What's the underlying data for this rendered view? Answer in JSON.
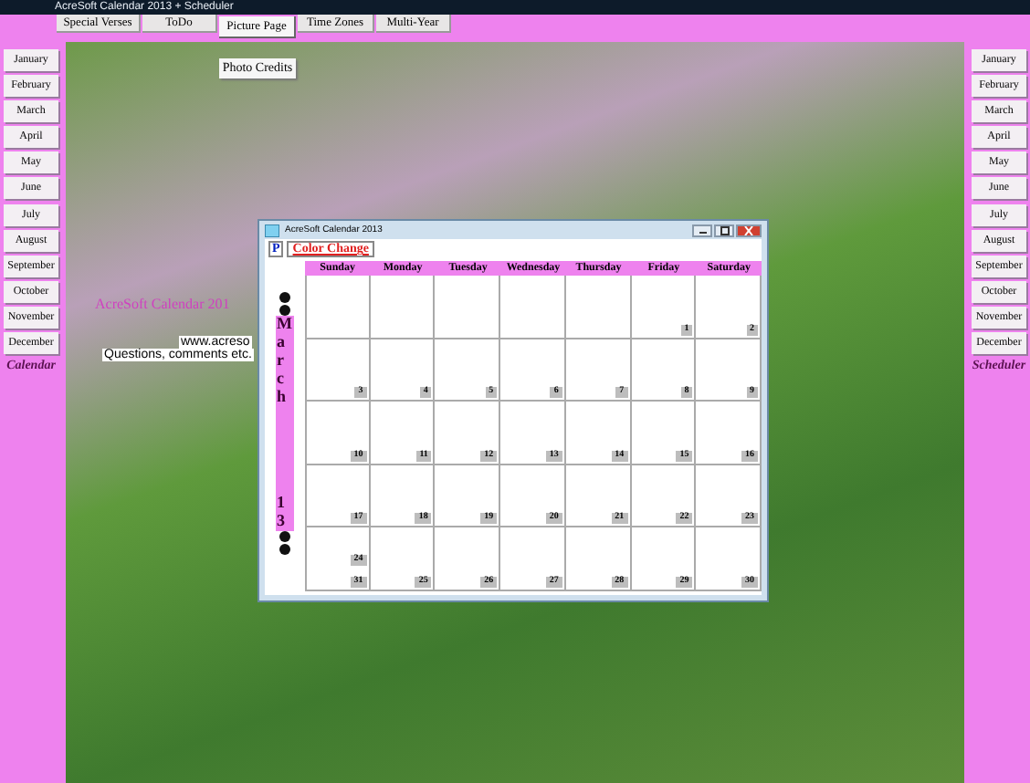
{
  "window": {
    "title": "AcreSoft Calendar 2013 + Scheduler"
  },
  "tabs": [
    {
      "label": "Special Verses",
      "selected": false
    },
    {
      "label": "ToDo",
      "selected": false
    },
    {
      "label": "Picture Page",
      "selected": true
    },
    {
      "label": "Time Zones",
      "selected": false
    },
    {
      "label": "Multi-Year",
      "selected": false
    }
  ],
  "dropdown": {
    "items": [
      "Photo Credits"
    ]
  },
  "left_sidebar": {
    "months": [
      "January",
      "February",
      "March",
      "April",
      "May",
      "June",
      "July",
      "August",
      "September",
      "October",
      "November",
      "December"
    ],
    "label": "Calendar"
  },
  "right_sidebar": {
    "months": [
      "January",
      "February",
      "March",
      "April",
      "May",
      "June",
      "July",
      "August",
      "September",
      "October",
      "November",
      "December"
    ],
    "label": "Scheduler"
  },
  "background_texts": [
    {
      "kind": "title",
      "text": "AcreSoft Calendar 201"
    },
    {
      "kind": "link",
      "text": "www.acreso"
    },
    {
      "kind": "note",
      "text": "Questions, comments etc."
    }
  ],
  "calendar_window": {
    "title": "AcreSoft Calendar 2013",
    "toolbar": [
      {
        "kind": "p",
        "label": "P"
      },
      {
        "kind": "color",
        "label": "Color Change"
      }
    ],
    "month": "March",
    "year": "13",
    "days": [
      "Sunday",
      "Monday",
      "Tuesday",
      "Wednesday",
      "Thursday",
      "Friday",
      "Saturday"
    ],
    "weeks": [
      [
        {
          "numbers": [
            "1"
          ]
        },
        {
          "numbers": [
            "2"
          ]
        }
      ],
      [
        {
          "numbers": [
            "3"
          ]
        },
        {
          "numbers": [
            "4"
          ]
        },
        {
          "numbers": [
            "5"
          ]
        },
        {
          "numbers": [
            "6"
          ]
        },
        {
          "numbers": [
            "7"
          ]
        },
        {
          "numbers": [
            "8"
          ]
        },
        {
          "numbers": [
            "9"
          ]
        }
      ],
      [
        {
          "numbers": [
            "10"
          ]
        },
        {
          "numbers": [
            "11"
          ]
        },
        {
          "numbers": [
            "12"
          ]
        },
        {
          "numbers": [
            "13"
          ]
        },
        {
          "numbers": [
            "14"
          ]
        },
        {
          "numbers": [
            "15"
          ]
        },
        {
          "numbers": [
            "16"
          ]
        }
      ],
      [
        {
          "numbers": [
            "17"
          ]
        },
        {
          "numbers": [
            "18"
          ]
        },
        {
          "numbers": [
            "19"
          ]
        },
        {
          "numbers": [
            "20"
          ]
        },
        {
          "numbers": [
            "21"
          ]
        },
        {
          "numbers": [
            "22"
          ]
        },
        {
          "numbers": [
            "23"
          ]
        }
      ],
      [
        {
          "numbers": [
            "24",
            "31"
          ]
        },
        {
          "numbers": [
            "25"
          ]
        },
        {
          "numbers": [
            "26"
          ]
        },
        {
          "numbers": [
            "27"
          ]
        },
        {
          "numbers": [
            "28"
          ]
        },
        {
          "numbers": [
            "29"
          ]
        },
        {
          "numbers": [
            "30"
          ]
        }
      ]
    ]
  }
}
